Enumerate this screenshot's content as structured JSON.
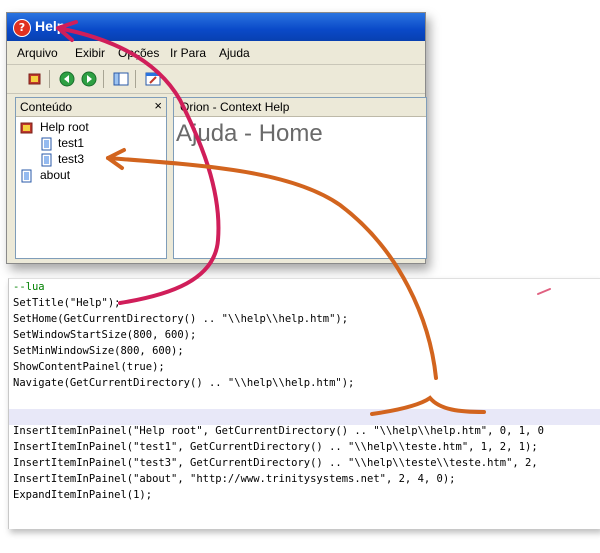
{
  "window": {
    "title": "Help",
    "menu": [
      "Arquivo",
      "Exibir",
      "Opções",
      "Ir Para",
      "Ajuda"
    ],
    "toolbar_icons": [
      "book-icon",
      "back-icon",
      "forward-icon",
      "pane-icon",
      "window-icon"
    ],
    "left_panel": {
      "header": "Conteúdo",
      "close": "×",
      "tree": [
        "Help root",
        "test1",
        "test3",
        "about"
      ]
    },
    "right_panel": {
      "header": "Orion - Context Help",
      "page_heading": "Ajuda - Home"
    }
  },
  "code": {
    "lines": [
      "--lua",
      "SetTitle(\"Help\");",
      "SetHome(GetCurrentDirectory() .. \"\\\\help\\\\help.htm\");",
      "SetWindowStartSize(800, 600);",
      "SetMinWindowSize(800, 600);",
      "ShowContentPainel(true);",
      "Navigate(GetCurrentDirectory() .. \"\\\\help\\\\help.htm\");",
      "",
      "",
      "InsertItemInPainel(\"Help root\", GetCurrentDirectory() .. \"\\\\help\\\\help.htm\", 0, 1, 0",
      "InsertItemInPainel(\"test1\", GetCurrentDirectory() .. \"\\\\help\\\\teste.htm\", 1, 2, 1);",
      "InsertItemInPainel(\"test3\", GetCurrentDirectory() .. \"\\\\help\\\\teste\\\\teste.htm\", 2,",
      "InsertItemInPainel(\"about\", \"http://www.trinitysystems.net\", 2, 4, 0);",
      "ExpandItemInPainel(1);"
    ]
  },
  "colors": {
    "title_bar": "#0a49c8",
    "arrow_pink": "#d01e5a",
    "arrow_orange": "#d2641e",
    "comment": "#008000"
  }
}
